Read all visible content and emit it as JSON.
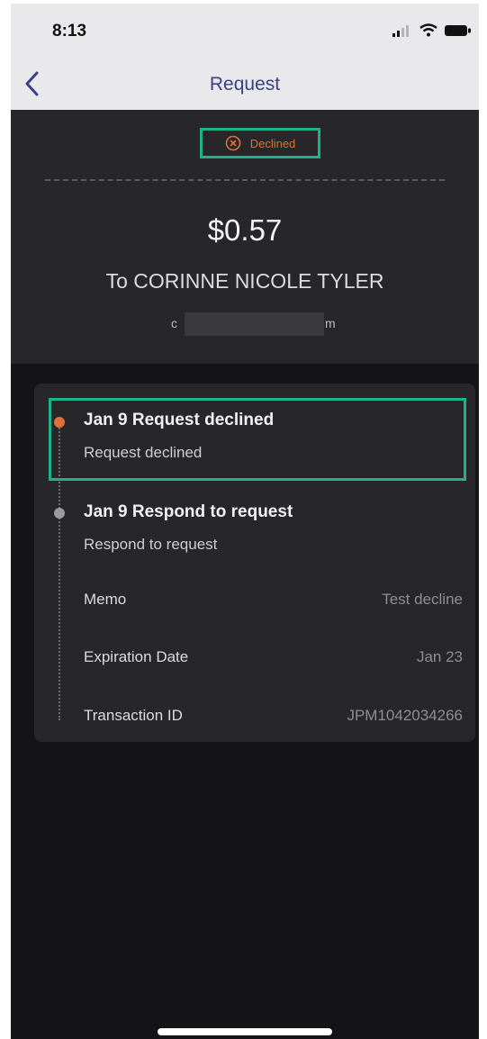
{
  "status_bar": {
    "time": "8:13"
  },
  "nav": {
    "title": "Request"
  },
  "summary": {
    "status": "Declined",
    "amount": "$0.57",
    "recipient": "To CORINNE NICOLE TYLER",
    "email_start": "c",
    "email_end": "m"
  },
  "timeline": [
    {
      "title": "Jan 9 Request declined",
      "subtitle": "Request declined"
    },
    {
      "title": "Jan 9 Respond to request",
      "subtitle": "Respond to request"
    }
  ],
  "details": [
    {
      "label": "Memo",
      "value": "Test decline"
    },
    {
      "label": "Expiration Date",
      "value": "Jan 23"
    },
    {
      "label": "Transaction ID",
      "value": "JPM1042034266"
    }
  ],
  "colors": {
    "accent_highlight": "#1fb28a",
    "declined": "#e0703a",
    "nav_title": "#3b3f86"
  },
  "icons": [
    "back-chevron-icon",
    "declined-x-icon",
    "signal-icon",
    "wifi-icon",
    "battery-icon"
  ]
}
